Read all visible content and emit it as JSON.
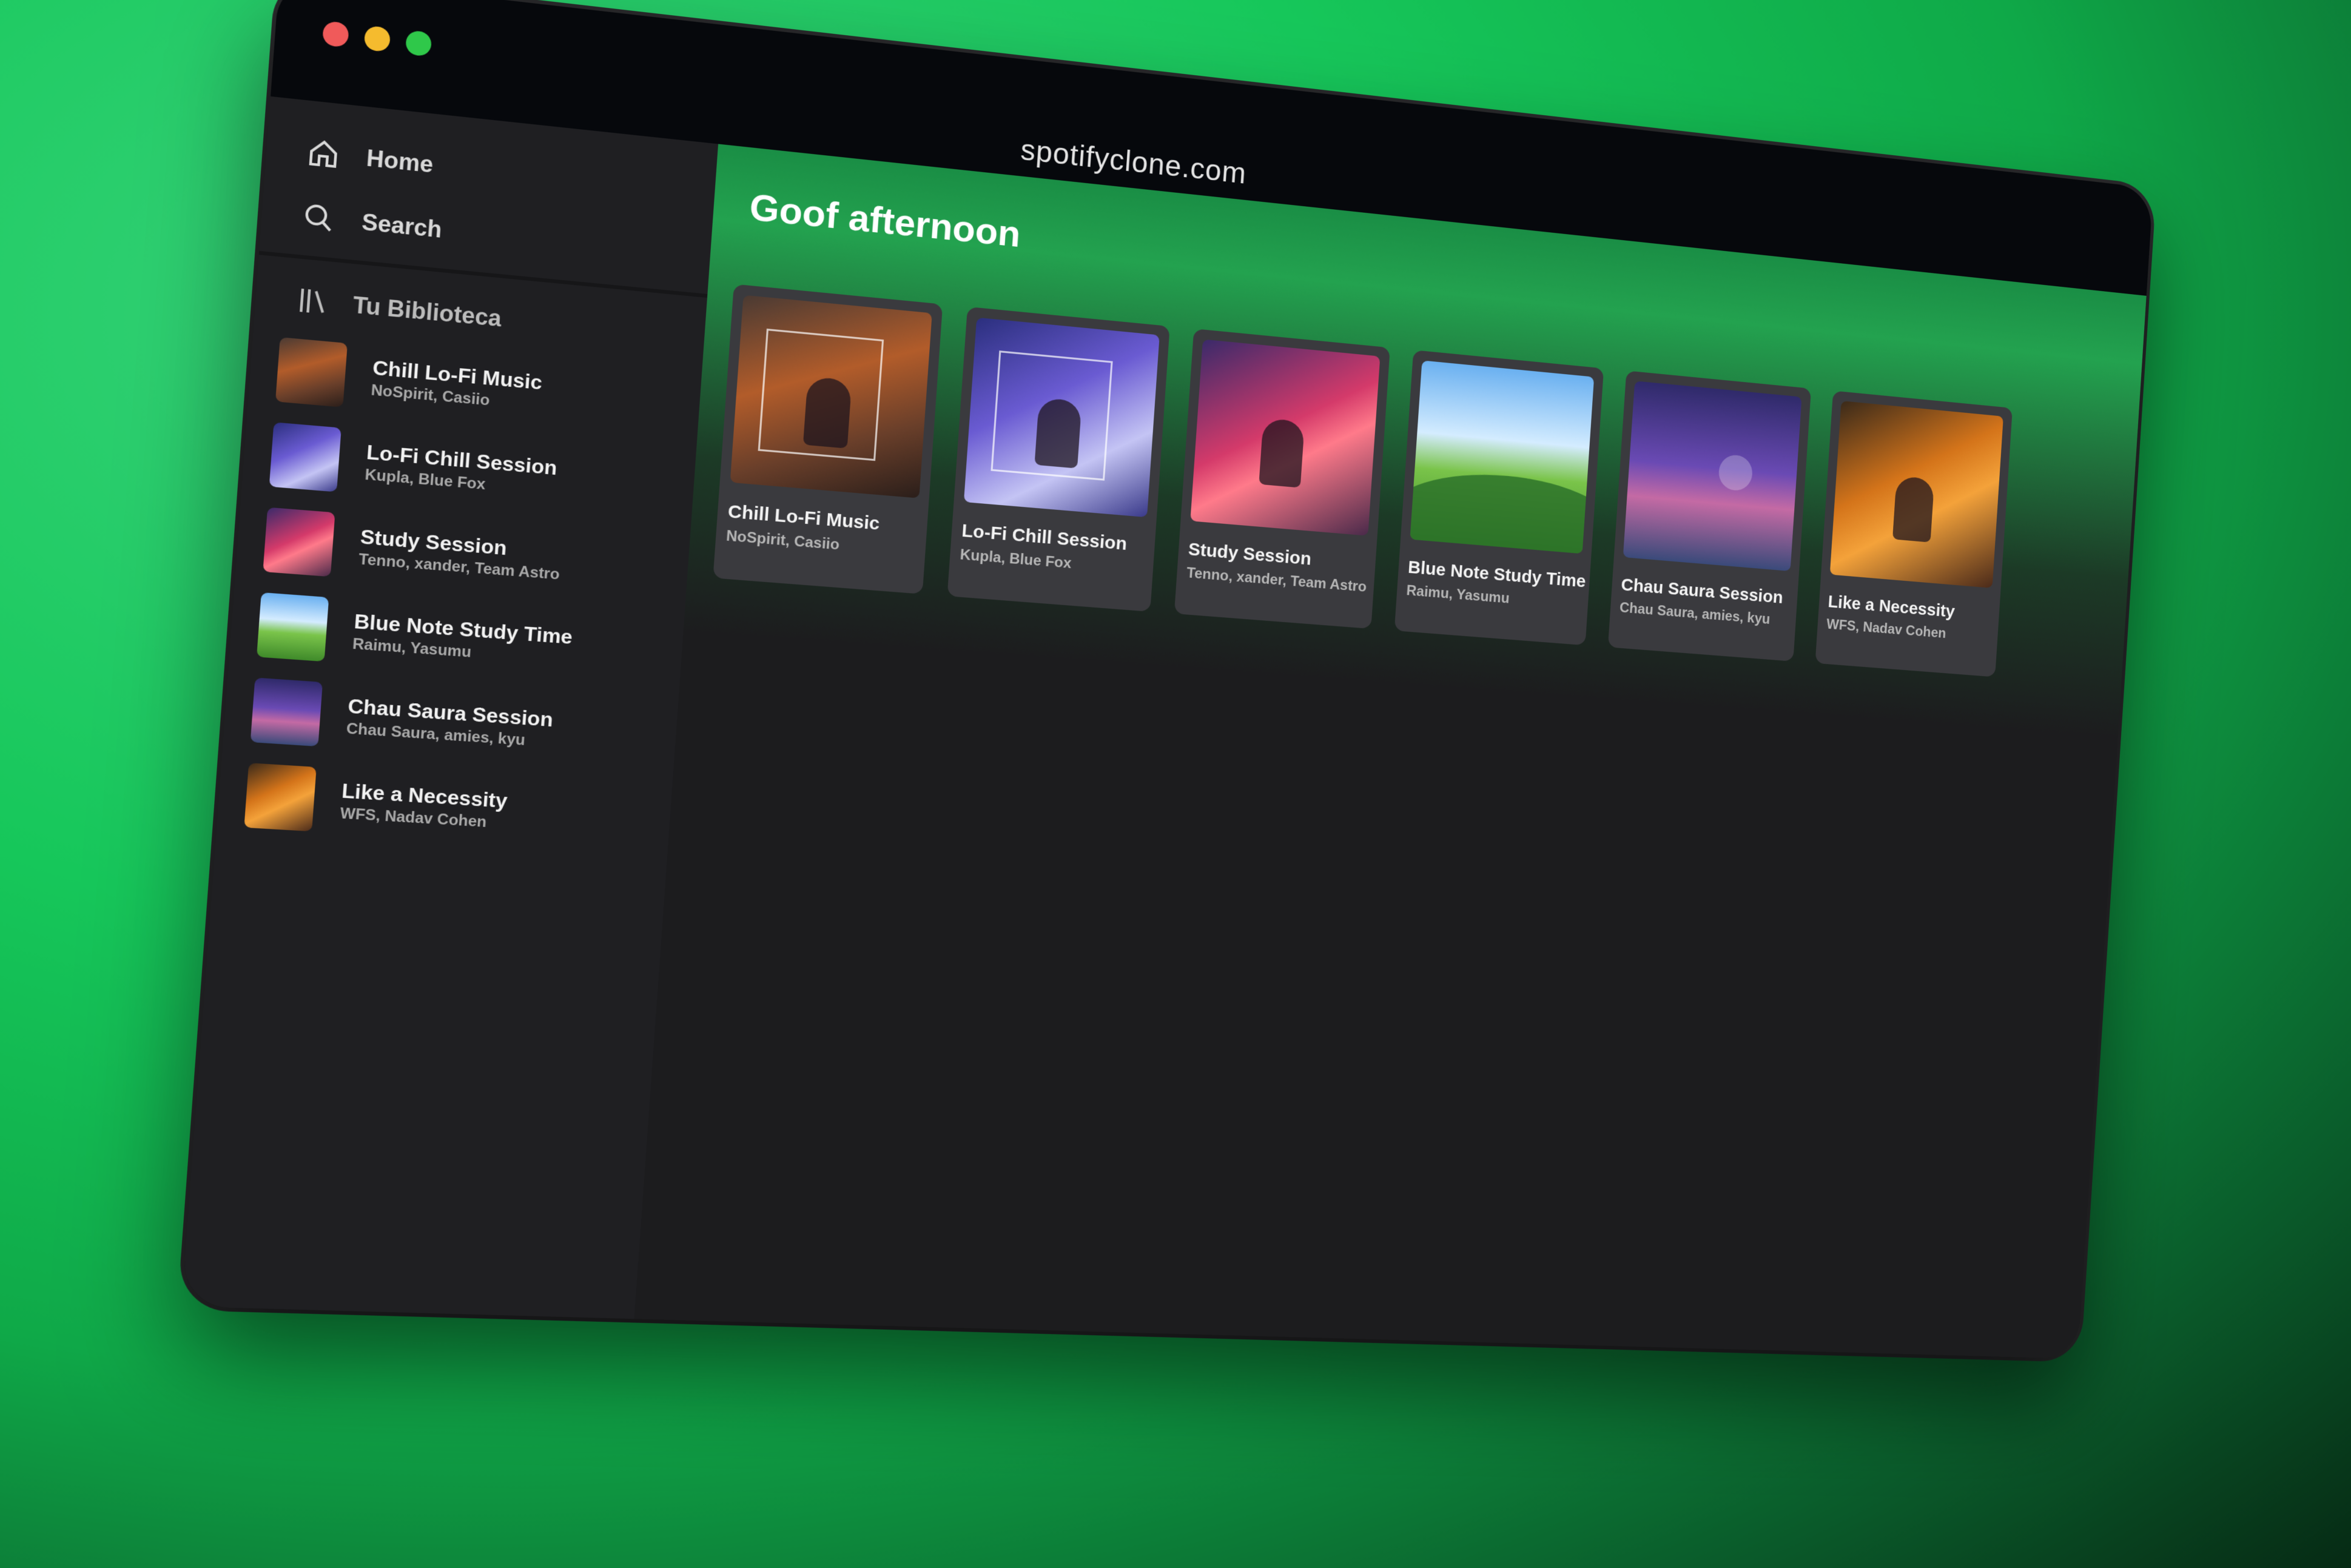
{
  "window": {
    "url": "spotifyclone.com",
    "traffic_lights": [
      "close",
      "minimize",
      "maximize"
    ]
  },
  "sidebar": {
    "nav": [
      {
        "label": "Home",
        "icon": "home-icon"
      },
      {
        "label": "Search",
        "icon": "search-icon"
      }
    ],
    "library": {
      "label": "Tu Biblioteca",
      "icon": "library-icon",
      "items": [
        {
          "title": "Chill Lo-Fi Music",
          "artists": "NoSpirit, Casiio"
        },
        {
          "title": "Lo-Fi Chill Session",
          "artists": "Kupla, Blue Fox"
        },
        {
          "title": "Study Session",
          "artists": "Tenno, xander, Team Astro"
        },
        {
          "title": "Blue Note Study Time",
          "artists": "Raimu, Yasumu"
        },
        {
          "title": "Chau Saura Session",
          "artists": "Chau Saura, amies, kyu"
        },
        {
          "title": "Like a Necessity",
          "artists": "WFS, Nadav Cohen"
        }
      ]
    }
  },
  "main": {
    "greeting": "Goof afternoon",
    "cards": [
      {
        "title": "Chill Lo-Fi Music",
        "artists": "NoSpirit, Casiio"
      },
      {
        "title": "Lo-Fi Chill Session",
        "artists": "Kupla, Blue Fox"
      },
      {
        "title": "Study Session",
        "artists": "Tenno, xander, Team Astro"
      },
      {
        "title": "Blue Note Study Time",
        "artists": "Raimu, Yasumu"
      },
      {
        "title": "Chau Saura Session",
        "artists": "Chau Saura, amies, kyu"
      },
      {
        "title": "Like a Necessity",
        "artists": "WFS, Nadav Cohen"
      }
    ]
  },
  "colors": {
    "accent": "#1DB954",
    "background": "#1c1c1e",
    "titlebar": "#06080c"
  }
}
